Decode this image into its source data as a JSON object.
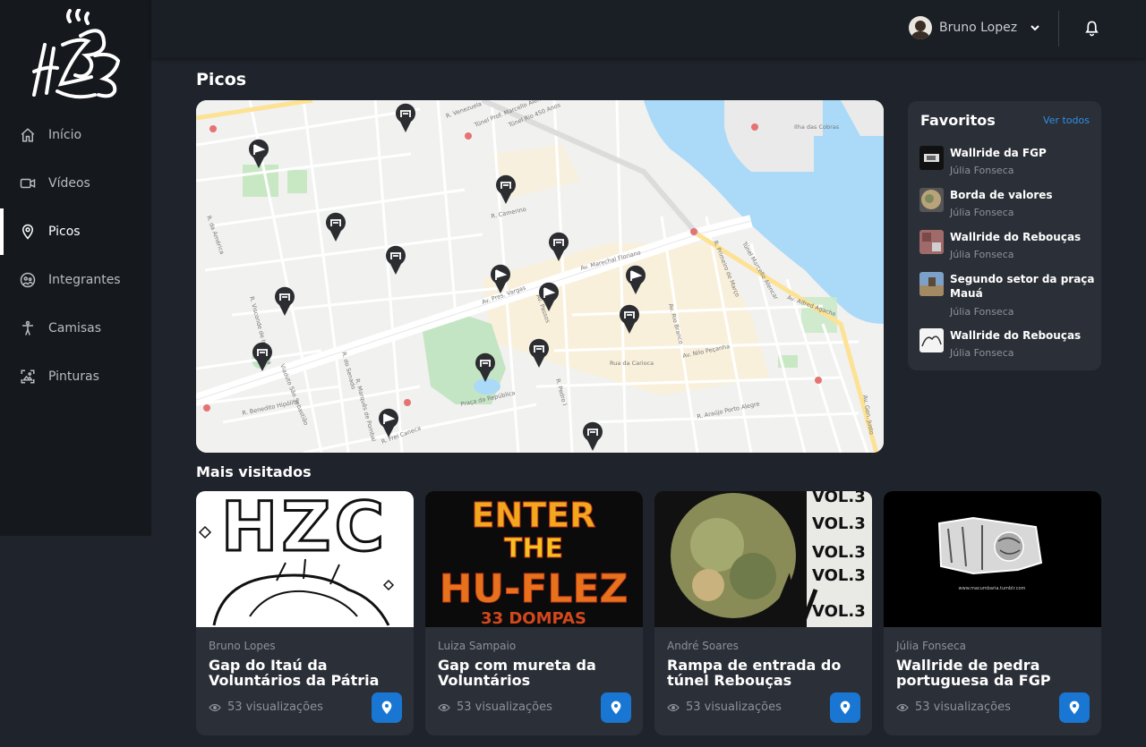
{
  "nav": {
    "items": [
      {
        "label": "Início",
        "icon": "home-icon"
      },
      {
        "label": "Vídeos",
        "icon": "video-icon"
      },
      {
        "label": "Picos",
        "icon": "location-pin-icon",
        "active": true
      },
      {
        "label": "Integrantes",
        "icon": "people-icon"
      },
      {
        "label": "Camisas",
        "icon": "person-icon"
      },
      {
        "label": "Pinturas",
        "icon": "painting-icon"
      }
    ]
  },
  "header": {
    "user_name": "Bruno Lopez"
  },
  "main": {
    "title": "Picos"
  },
  "map": {
    "street_labels": [
      "Túnel Prof. Marcello Alencar",
      "R. Venezuela",
      "Túnel Rio 450 Anos",
      "Ilha das Cobras",
      "R. da América",
      "R. Camerino",
      "Av. Pres. Vargas",
      "Av. Marechal Floriano",
      "Av. Passos",
      "Av. Rio Branco",
      "R. Primeiro de Março",
      "Av. Alfred Agache",
      "Rua da Carioca",
      "Av. Nilo Peçanha",
      "Praça da República",
      "R. Benedito Hipólito",
      "R. Frei Caneca",
      "R. Visconde de Inhaúma",
      "Túnel Marcello Alencar",
      "Av. Gen. Justo",
      "R. Araújo Porto Alegre",
      "R. Pedro I",
      "R. do Senado",
      "Viaduto São Sebastião",
      "R. Marquês de Pombal"
    ]
  },
  "favorites": {
    "title": "Favoritos",
    "see_all": "Ver todos",
    "items": [
      {
        "name": "Wallride da FGP",
        "author": "Júlia Fonseca"
      },
      {
        "name": "Borda de valores",
        "author": "Júlia Fonseca"
      },
      {
        "name": "Wallride do Rebouças",
        "author": "Júlia Fonseca"
      },
      {
        "name": "Segundo setor da praça Mauá",
        "author": "Júlia Fonseca"
      },
      {
        "name": "Wallride do Rebouças",
        "author": "Júlia Fonseca"
      }
    ]
  },
  "most_visited": {
    "title": "Mais visitados",
    "cards": [
      {
        "author": "Bruno Lopes",
        "title": "Gap do Itaú da Voluntários da Pátria",
        "views": "53 visualizações",
        "image_text": "HZC"
      },
      {
        "author": "Luiza Sampaio",
        "title": "Gap com mureta da Voluntários",
        "views": "53 visualizações",
        "image_text": [
          "ENTER",
          "THE",
          "HU-FLEZ",
          "33 DOMPAS"
        ]
      },
      {
        "author": "André Soares",
        "title": "Rampa de entrada do túnel Rebouças",
        "views": "53 visualizações",
        "image_text": "VOL.3"
      },
      {
        "author": "Júlia Fonseca",
        "title": "Wallride de pedra portuguesa da FGP",
        "views": "53 visualizações",
        "image_text": "www.macumbaria.tumblr.com"
      }
    ]
  },
  "colors": {
    "accent": "#1976d2",
    "link": "#2f8fe6",
    "background": "#1f232b",
    "sidebar": "#15181d",
    "card": "#2b2f37"
  }
}
